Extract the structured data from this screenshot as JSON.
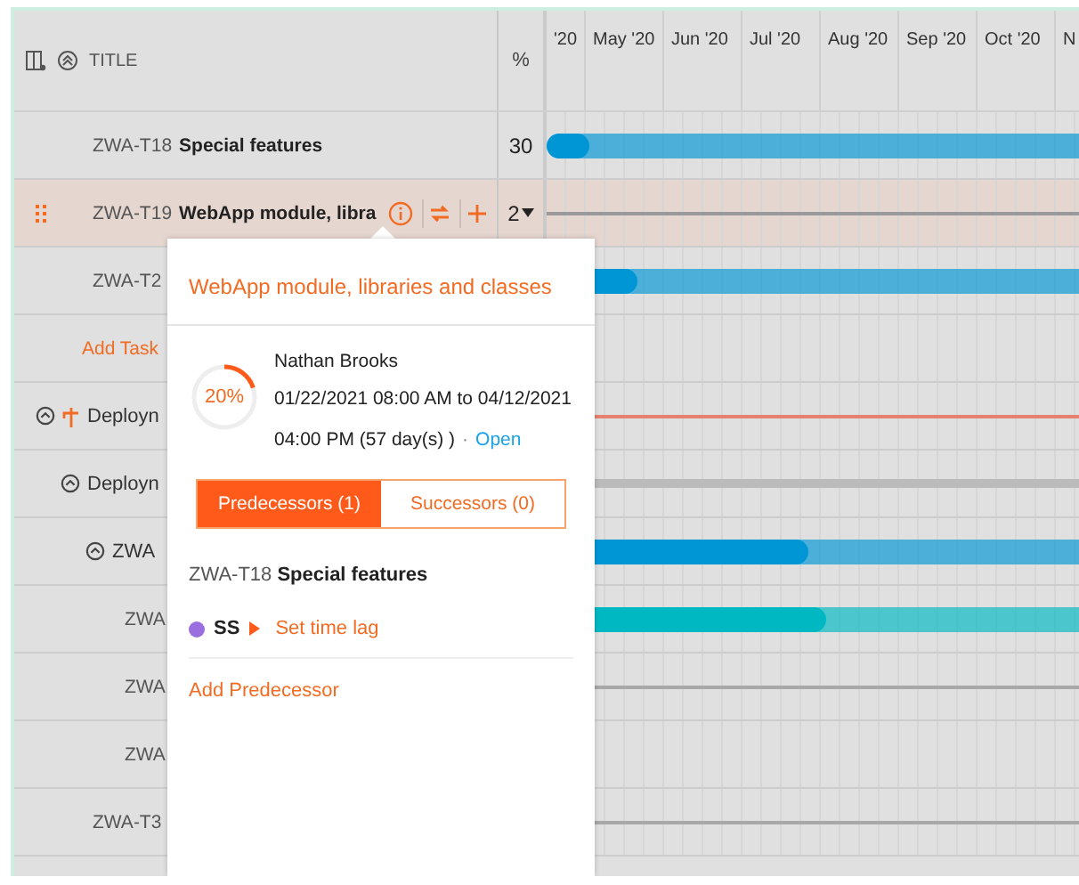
{
  "header": {
    "title": "TITLE",
    "percent": "%",
    "months": [
      "'20",
      "May '20",
      "Jun '20",
      "Jul '20",
      "Aug '20",
      "Sep '20",
      "Oct '20",
      "N"
    ]
  },
  "rows": [
    {
      "kind": "task",
      "id": "ZWA-T18",
      "title": "Special features",
      "percent": "30",
      "selected": false,
      "bar": {
        "kind": "progress",
        "level": 0.08,
        "color": "#0096d6"
      }
    },
    {
      "kind": "task",
      "id": "ZWA-T19",
      "title": "WebApp module, libra",
      "percent": "2",
      "selected": true,
      "bar": {
        "kind": "line",
        "color": "#9a9a9a"
      }
    },
    {
      "kind": "task",
      "id": "ZWA-T2",
      "selected": false,
      "bar": {
        "kind": "progress",
        "level": 0.17,
        "color": "#0096d6"
      }
    },
    {
      "kind": "add",
      "label": "Add Task",
      "selected": false,
      "bar": {
        "kind": "none"
      }
    },
    {
      "kind": "milestone",
      "label": "Deployn",
      "selected": false,
      "bar": {
        "kind": "line",
        "color": "#e88070"
      },
      "children": [
        {
          "kind": "group",
          "label": "Deployn",
          "selected": false,
          "bar": {
            "kind": "thick",
            "color": "#bbbbbb"
          },
          "children": [
            {
              "kind": "group",
              "label": "ZWA",
              "selected": false,
              "bar": {
                "kind": "progress",
                "level": 0.49,
                "color": "#0096d6"
              },
              "children": [
                {
                  "kind": "task",
                  "id": "ZWA",
                  "selected": false,
                  "bar": {
                    "kind": "progress",
                    "level": 0.52,
                    "color": "#00b8c2"
                  }
                },
                {
                  "kind": "task",
                  "id": "ZWA",
                  "selected": false,
                  "bar": {
                    "kind": "line",
                    "color": "#a8a8a8"
                  }
                },
                {
                  "kind": "task",
                  "id": "ZWA",
                  "selected": false,
                  "bar": {
                    "kind": "none"
                  }
                }
              ]
            }
          ]
        }
      ]
    },
    {
      "kind": "task",
      "id": "ZWA-T3",
      "selected": false,
      "bar": {
        "kind": "line",
        "color": "#a8a8a8"
      }
    }
  ],
  "popup": {
    "title": "WebApp module, libraries and classes",
    "progress": {
      "label": "20%",
      "level": 0.2
    },
    "owner": "Nathan Brooks",
    "dates": "01/22/2021 08:00 AM to 04/12/2021 04:00 PM (57 day(s) )",
    "separator": "·",
    "status": "Open",
    "tabs": [
      {
        "label": "Predecessors (1)",
        "selected": true
      },
      {
        "label": "Successors (0)",
        "selected": false
      }
    ],
    "dependency": {
      "id": "ZWA-T18",
      "title": "Special features",
      "type": "SS",
      "color": "#9b6ee0",
      "action": "Set time lag"
    },
    "add_link": "Add Predecessor"
  }
}
